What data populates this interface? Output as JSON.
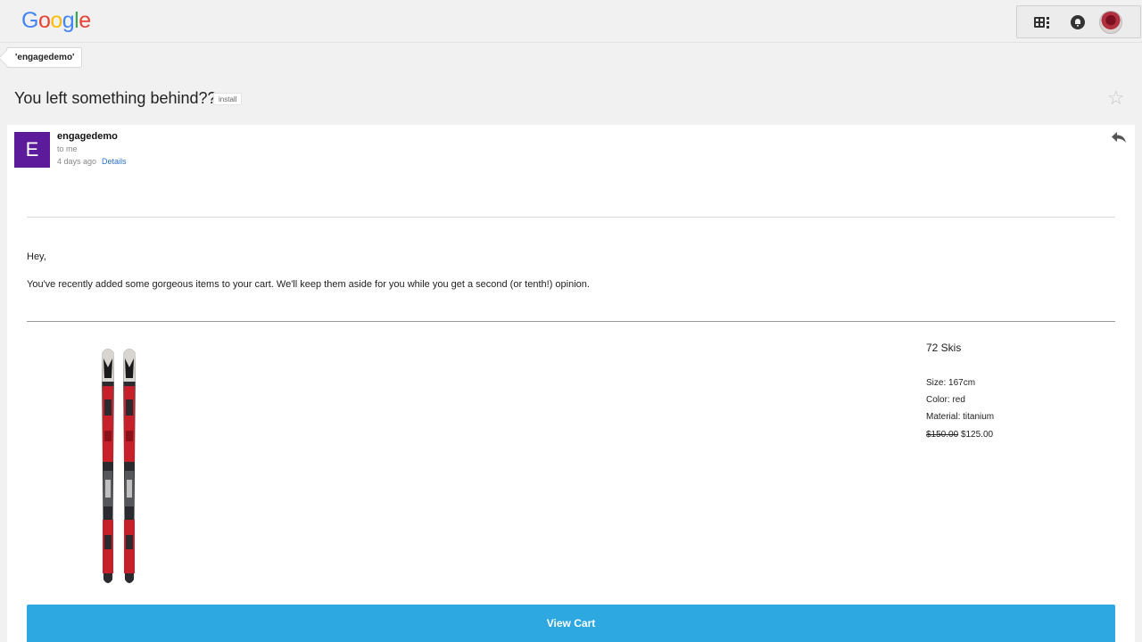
{
  "header": {
    "logo_letters": [
      {
        "char": "G",
        "color": "#4285f4"
      },
      {
        "char": "o",
        "color": "#ea4335"
      },
      {
        "char": "o",
        "color": "#fbbc05"
      },
      {
        "char": "g",
        "color": "#4285f4"
      },
      {
        "char": "l",
        "color": "#34a853"
      },
      {
        "char": "e",
        "color": "#ea4335"
      }
    ],
    "tool_icons": [
      "apps-grid-icon",
      "notifications-icon",
      "user-avatar"
    ]
  },
  "label_chip": "'engagedemo'",
  "email": {
    "subject": "You left something behind??",
    "tag": "install",
    "sender": {
      "initial": "E",
      "avatar_color": "#5c1b9a",
      "name": "engagedemo",
      "to": "to me",
      "date": "4 days ago",
      "details_link": "Details"
    },
    "body": {
      "greeting": "Hey,",
      "intro": "You've recently added some gorgeous items to your cart. We'll keep them aside for you while you get a second (or tenth!) opinion."
    },
    "product": {
      "name": "72 Skis",
      "size": "Size: 167cm",
      "color": "Color: red",
      "material": "Material: titanium",
      "old_price": "$150.00",
      "new_price": "$125.00"
    },
    "cta": "View Cart",
    "cta_color": "#2ea8e0"
  }
}
